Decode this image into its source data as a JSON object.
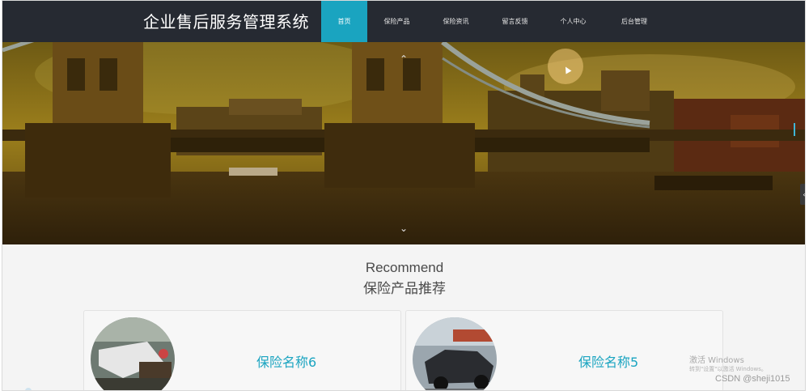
{
  "header": {
    "site_title": "企业售后服务管理系统",
    "nav": [
      {
        "label": "首页",
        "active": true
      },
      {
        "label": "保险产品",
        "active": false
      },
      {
        "label": "保险资讯",
        "active": false
      },
      {
        "label": "留言反馈",
        "active": false
      },
      {
        "label": "个人中心",
        "active": false
      },
      {
        "label": "后台管理",
        "active": false
      }
    ]
  },
  "banner": {
    "prev_icon": "chevron-up-icon",
    "next_icon": "chevron-down-icon",
    "side_tab_icon": "chevron-left-icon",
    "up_glyph": "⌃",
    "down_glyph": "⌄",
    "side_glyph": "‹"
  },
  "recommend": {
    "title_en": "Recommend",
    "title_cn": "保险产品推荐",
    "items": [
      {
        "name": "保险名称6"
      },
      {
        "name": "保险名称5"
      }
    ]
  },
  "watermark": {
    "windows_line1": "激活 Windows",
    "windows_line2": "转到\"设置\"以激活 Windows。",
    "csdn": "CSDN @sheji1015"
  },
  "colors": {
    "accent": "#1aa4c0",
    "topbar": "#262a32"
  }
}
